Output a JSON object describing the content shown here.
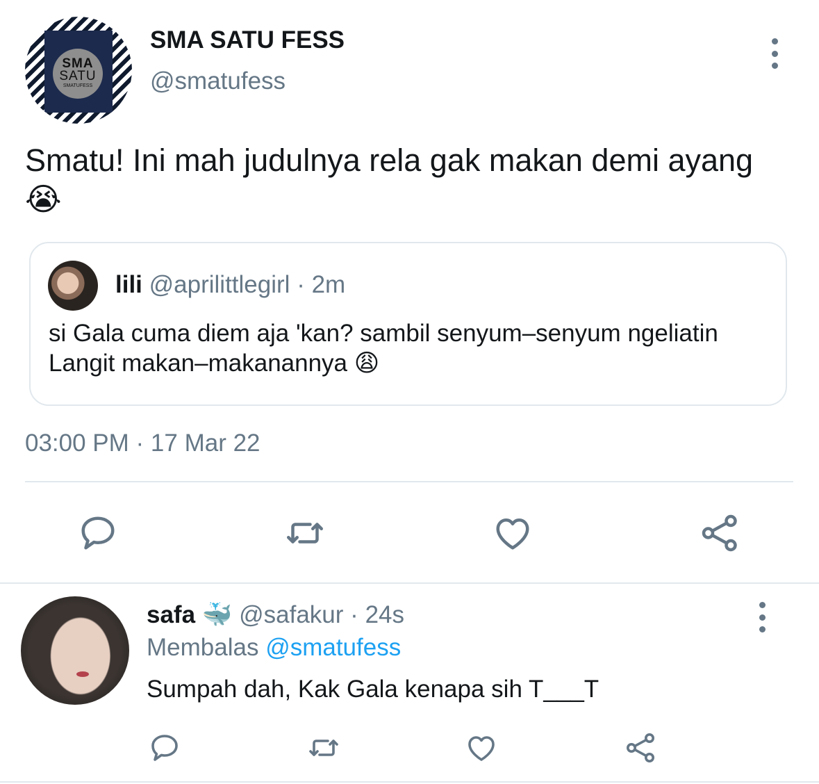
{
  "tweet": {
    "display_name": "SMA SATU FESS",
    "handle": "@smatufess",
    "avatar": {
      "line1": "SMA",
      "line2": "SATU",
      "line3": "SMATUFESS"
    },
    "text": "Smatu! Ini mah judulnya rela gak makan demi ayang 😭",
    "timestamp": "03:00 PM · 17 Mar 22"
  },
  "quoted": {
    "name": "lili",
    "handle": "@aprilittlegirl",
    "time": "2m",
    "text": "si Gala cuma diem aja 'kan? sambil senyum–senyum ngeliatin Langit makan–makanannya 😩"
  },
  "reply": {
    "name": "safa",
    "badge": "🐳",
    "handle": "@safakur",
    "time": "24s",
    "replying_label": "Membalas",
    "replying_to": "@smatufess",
    "text": "Sumpah dah, Kak Gala kenapa sih T___T"
  },
  "icons": {
    "actions": [
      "reply-icon",
      "retweet-icon",
      "like-icon",
      "share-icon"
    ],
    "menu": "more-icon"
  },
  "colors": {
    "text": "#14171a",
    "secondary": "#657786",
    "link": "#1da1f2",
    "divider": "#e1e8ed"
  }
}
